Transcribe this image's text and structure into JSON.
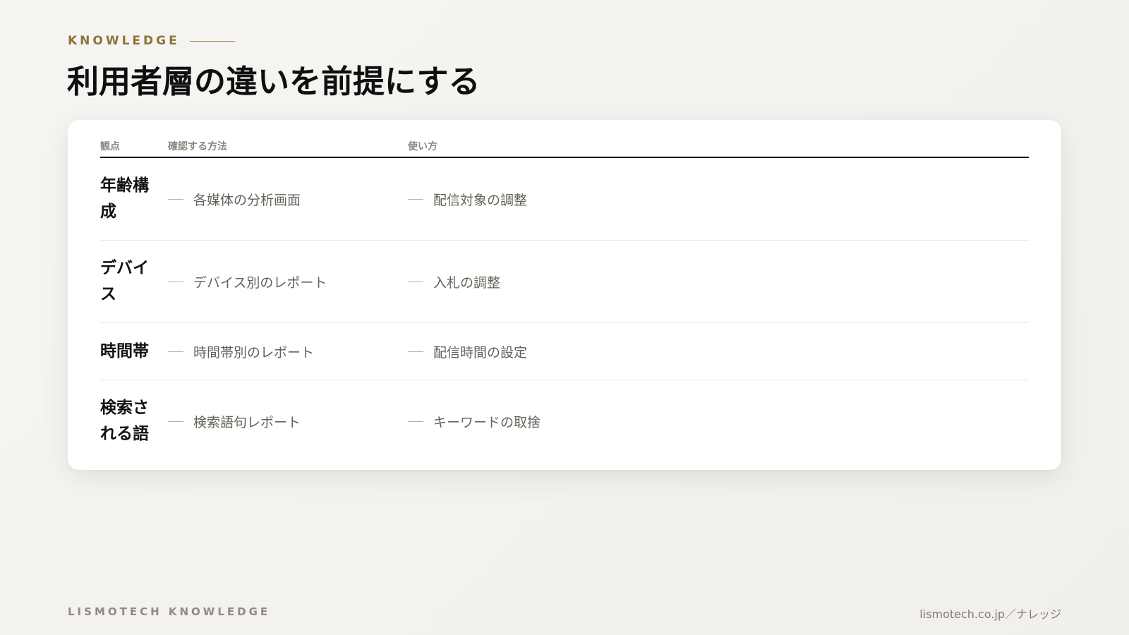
{
  "eyebrow": "KNOWLEDGE",
  "title": "利用者層の違いを前提にする",
  "table": {
    "headers": [
      "観点",
      "確認する方法",
      "使い方"
    ],
    "rows": [
      {
        "aspect": "年齢構成",
        "method": "各媒体の分析画面",
        "usage": "配信対象の調整"
      },
      {
        "aspect": "デバイス",
        "method": "デバイス別のレポート",
        "usage": "入札の調整"
      },
      {
        "aspect": "時間帯",
        "method": "時間帯別のレポート",
        "usage": "配信時間の設定"
      },
      {
        "aspect": "検索される語",
        "method": "検索語句レポート",
        "usage": "キーワードの取捨"
      }
    ]
  },
  "footer": {
    "brand": "LISMOTECH KNOWLEDGE",
    "url": "lismotech.co.jp／ナレッジ"
  },
  "colors": {
    "accent": "#8a7438",
    "background": "#f4f3f0",
    "card": "#ffffff",
    "text": "#111111",
    "muted": "#66625a"
  }
}
